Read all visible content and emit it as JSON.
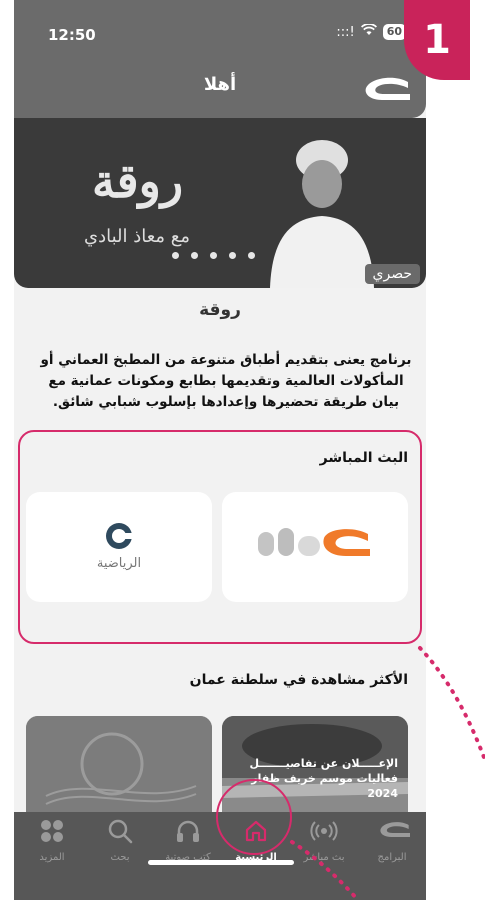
{
  "status": {
    "time": "12:50",
    "signal": ":::!",
    "wifi": "wifi-icon",
    "battery": "60"
  },
  "badge": {
    "number": "1"
  },
  "appbar": {
    "title": "أهلا",
    "logo": "oman-tv-logo"
  },
  "banner": {
    "title": "روقة",
    "subtitle": "مع معاذ البادي",
    "exclusive": "حصري",
    "slide_count": 5
  },
  "show": {
    "title": "روقة",
    "description": "برنامج يعنى بتقديم أطباق متنوعة من المطبخ العماني أو المأكولات العالمية وتقديمها بطابع ومكونات عمانية مع بيان طريقة تحضيرها وإعدادها بإسلوب شبابي شائق."
  },
  "live": {
    "heading": "البث المباشر",
    "channels": [
      {
        "name": "oman-tv",
        "label": ""
      },
      {
        "name": "oman-sports",
        "label": "الرياضية"
      }
    ]
  },
  "most_watched": {
    "heading": "الأكثر مشاهدة في سلطنة عمان",
    "items": [
      {
        "text_line1": "الإعـــــلان عن تفاصيـــــــل",
        "text_line2": "فعاليات موسم خريف ظفار 2024"
      },
      {
        "text_line1": "",
        "text_line2": ""
      }
    ]
  },
  "nav": {
    "items": [
      {
        "label": "البرامج",
        "icon": "oman-logo-icon"
      },
      {
        "label": "بث مباشر",
        "icon": "live-broadcast-icon"
      },
      {
        "label": "الرئيسية",
        "icon": "home-icon"
      },
      {
        "label": "كتب صوتية",
        "icon": "headphones-icon"
      },
      {
        "label": "بحث",
        "icon": "search-icon"
      },
      {
        "label": "المزيد",
        "icon": "more-grid-icon"
      }
    ],
    "active_index": 2
  },
  "colors": {
    "highlight": "#d62b6b",
    "accent_orange": "#f07a2a"
  }
}
